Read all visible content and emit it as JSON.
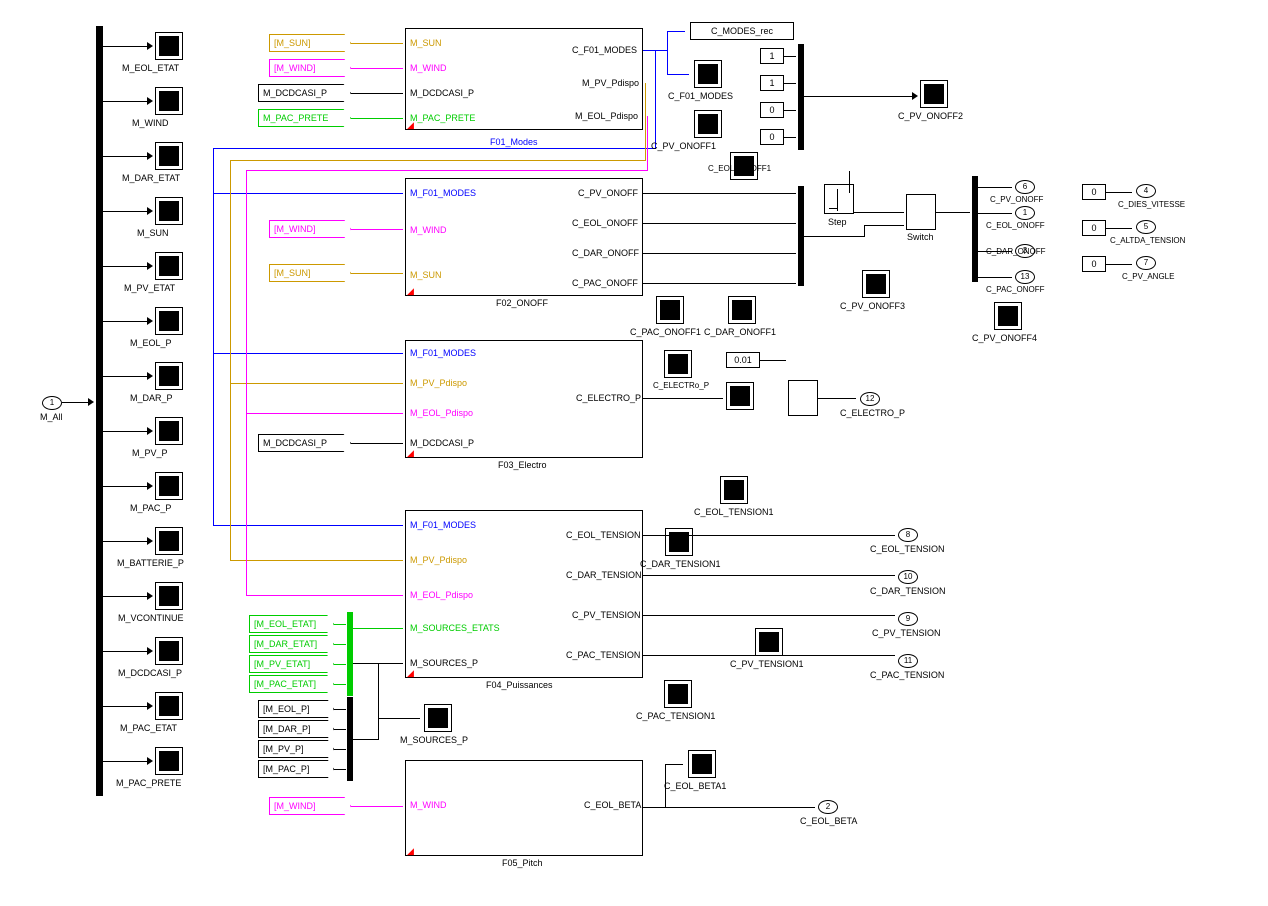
{
  "input_port": {
    "num": "1",
    "label": "M_All"
  },
  "demux_labels": [
    "M_EOL_ETAT",
    "M_WIND",
    "M_DAR_ETAT",
    "M_SUN",
    "M_PV_ETAT",
    "M_EOL_P",
    "M_DAR_P",
    "M_PV_P",
    "M_PAC_P",
    "M_BATTERIE_P",
    "M_VCONTINUE",
    "M_DCDCASI_P",
    "M_PAC_ETAT",
    "M_PAC_PRETE"
  ],
  "f01": {
    "name": "F01_Modes",
    "in_tags": [
      {
        "text": "[M_SUN]",
        "color": "#c90",
        "label": "M_SUN"
      },
      {
        "text": "[M_WIND]",
        "color": "#f0f",
        "label": "M_WIND"
      },
      {
        "text": "M_DCDCASI_P",
        "color": "#000",
        "label": "M_DCDCASI_P"
      },
      {
        "text": "M_PAC_PRETE",
        "color": "#0c0",
        "label": "M_PAC_PRETE"
      }
    ],
    "outs": [
      "C_F01_MODES",
      "M_PV_Pdispo",
      "M_EOL_Pdispo"
    ]
  },
  "f02": {
    "name": "F02_ONOFF",
    "in_labels": [
      "M_F01_MODES",
      "M_WIND",
      "M_SUN"
    ],
    "in_tags": [
      {
        "text": "[M_WIND]",
        "color": "#f0f"
      },
      {
        "text": "[M_SUN]",
        "color": "#c90"
      }
    ],
    "outs": [
      "C_PV_ONOFF",
      "C_EOL_ONOFF",
      "C_DAR_ONOFF",
      "C_PAC_ONOFF"
    ]
  },
  "f03": {
    "name": "F03_Electro",
    "in_labels": [
      "M_F01_MODES",
      "M_PV_Pdispo",
      "M_EOL_Pdispo",
      "M_DCDCASI_P"
    ],
    "in_tag": {
      "text": "M_DCDCASI_P",
      "color": "#000"
    },
    "outs": [
      "C_ELECTRO_P"
    ]
  },
  "f04": {
    "name": "F04_Puissances",
    "in_labels": [
      "M_F01_MODES",
      "M_PV_Pdispo",
      "M_EOL_Pdispo",
      "M_SOURCES_ETATS",
      "M_SOURCES_P"
    ],
    "outs": [
      "C_EOL_TENSION",
      "C_DAR_TENSION",
      "C_PV_TENSION",
      "C_PAC_TENSION"
    ]
  },
  "f05": {
    "name": "F05_Pitch",
    "in_labels": [
      "M_WIND"
    ],
    "in_tag": {
      "text": "[M_WIND]",
      "color": "#f0f"
    },
    "outs": [
      "C_EOL_BETA"
    ]
  },
  "mux_etats_tags": [
    "[M_EOL_ETAT]",
    "[M_DAR_ETAT]",
    "[M_PV_ETAT]",
    "[M_PAC_ETAT]"
  ],
  "mux_p_tags": [
    "[M_EOL_P]",
    "[M_DAR_P]",
    "[M_PV_P]",
    "[M_PAC_P]"
  ],
  "mux_p_scope": "M_SOURCES_P",
  "modes_rec": "C_MODES_rec",
  "scopes_mid": [
    "C_F01_MODES",
    "C_PV_ONOFF1",
    "C_EOL_ONOFF1",
    "C_PAC_ONOFF1",
    "C_DAR_ONOFF1",
    "C_ELECTRo_P"
  ],
  "mux_consts": [
    "1",
    "1",
    "0",
    "0"
  ],
  "pv_onoff2": "C_PV_ONOFF2",
  "step": "Step",
  "switch": "Switch",
  "pv_onoff3": "C_PV_ONOFF3",
  "pv_onoff4": "C_PV_ONOFF4",
  "out_ports_right": [
    {
      "num": "6",
      "label": "C_PV_ONOFF"
    },
    {
      "num": "1",
      "label": "C_EOL_ONOFF"
    },
    {
      "num": "3",
      "label": "C_DAR_ONOFF"
    },
    {
      "num": "13",
      "label": "C_PAC_ONOFF"
    }
  ],
  "far_right": [
    {
      "c": "0",
      "num": "4",
      "label": "C_DIES_VITESSE"
    },
    {
      "c": "0",
      "num": "5",
      "label": "C_ALTDA_TENSION"
    },
    {
      "c": "0",
      "num": "7",
      "label": "C_PV_ANGLE"
    }
  ],
  "electro_const": "0.01",
  "electro_out": {
    "num": "12",
    "label": "C_ELECTRO_P"
  },
  "tension_scopes": [
    "C_EOL_TENSION1",
    "C_DAR_TENSION1",
    "C_PV_TENSION1",
    "C_PAC_TENSION1"
  ],
  "tension_ports": [
    {
      "num": "8",
      "label": "C_EOL_TENSION"
    },
    {
      "num": "10",
      "label": "C_DAR_TENSION"
    },
    {
      "num": "9",
      "label": "C_PV_TENSION"
    },
    {
      "num": "11",
      "label": "C_PAC_TENSION"
    }
  ],
  "beta_scope": "C_EOL_BETA1",
  "beta_port": {
    "num": "2",
    "label": "C_EOL_BETA"
  }
}
